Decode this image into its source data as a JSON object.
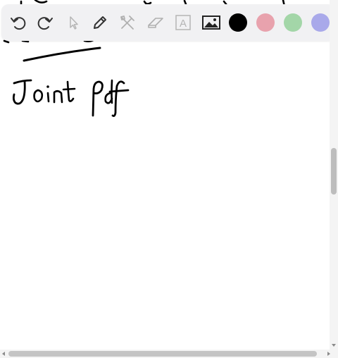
{
  "toolbar": {
    "tools": [
      {
        "id": "undo",
        "icon": "undo-icon"
      },
      {
        "id": "redo",
        "icon": "redo-icon"
      },
      {
        "id": "select",
        "icon": "cursor-icon"
      },
      {
        "id": "pen",
        "icon": "pencil-icon"
      },
      {
        "id": "tools",
        "icon": "hammer-wrench-icon"
      },
      {
        "id": "eraser",
        "icon": "eraser-icon"
      },
      {
        "id": "text",
        "icon": "text-box-icon",
        "glyph": "A"
      },
      {
        "id": "image",
        "icon": "image-icon"
      }
    ],
    "colors": [
      {
        "name": "black",
        "hex": "#000000",
        "selected": true
      },
      {
        "name": "pink",
        "hex": "#e8a2ad"
      },
      {
        "name": "green",
        "hex": "#a3d6a8"
      },
      {
        "name": "lavender",
        "hex": "#a9a9ea"
      }
    ]
  },
  "canvas": {
    "handwriting": "Joint pdf"
  }
}
